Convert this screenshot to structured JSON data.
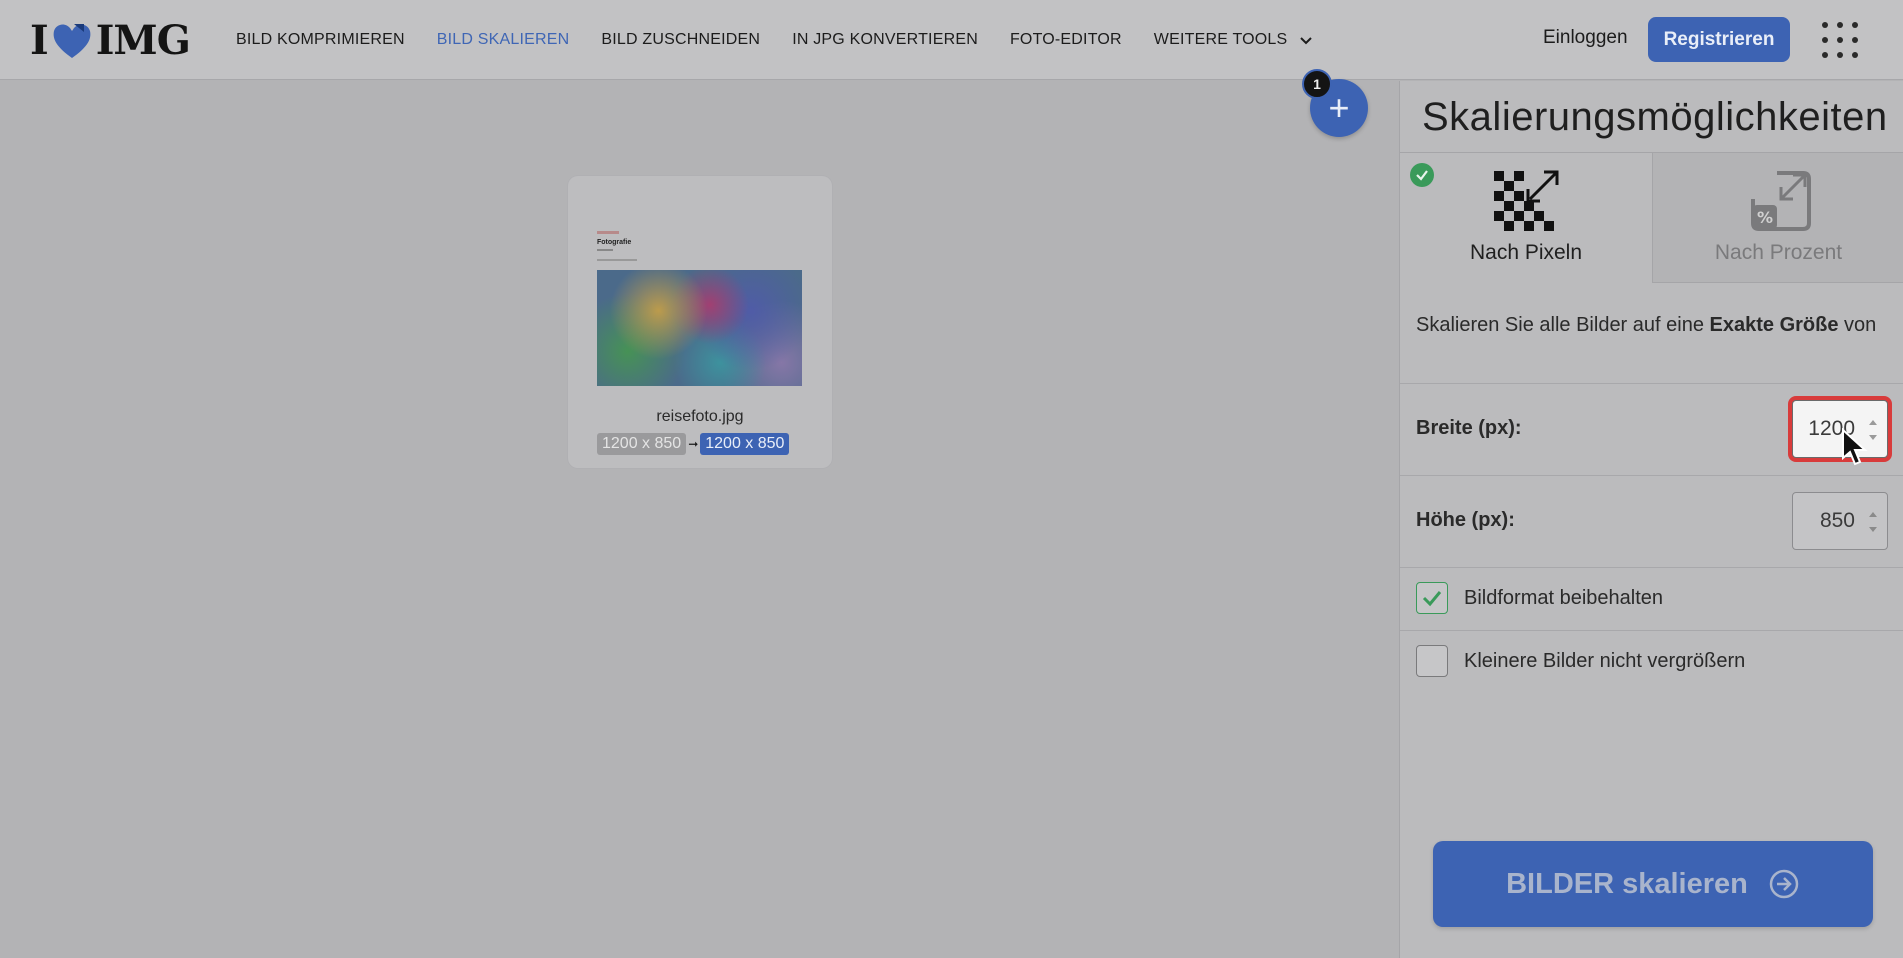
{
  "header": {
    "logo_left": "I",
    "logo_right": "IMG",
    "nav": [
      {
        "label": "BILD KOMPRIMIEREN",
        "active": false
      },
      {
        "label": "BILD SKALIEREN",
        "active": true
      },
      {
        "label": "BILD ZUSCHNEIDEN",
        "active": false
      },
      {
        "label": "IN JPG KONVERTIEREN",
        "active": false
      },
      {
        "label": "FOTO-EDITOR",
        "active": false
      },
      {
        "label": "WEITERE TOOLS",
        "active": false
      }
    ],
    "login_label": "Einloggen",
    "register_label": "Registrieren"
  },
  "workspace": {
    "file": {
      "name": "reisefoto.jpg",
      "original_size": "1200 x 850",
      "new_size": "1200 x 850",
      "preview_title": "Fotografie"
    },
    "file_count": "1",
    "add_label": "+"
  },
  "sidebar": {
    "title": "Skalierungsmöglichkeiten",
    "tabs": [
      {
        "label": "Nach Pixeln",
        "selected": true
      },
      {
        "label": "Nach Prozent",
        "selected": false
      }
    ],
    "description_prefix": "Skalieren Sie alle Bilder auf eine",
    "description_bold": "Exakte Größe",
    "description_suffix": "von",
    "width_label": "Breite (px):",
    "width_value": "1200",
    "height_label": "Höhe (px):",
    "height_value": "850",
    "keep_ratio_label": "Bildformat beibehalten",
    "keep_ratio_checked": true,
    "no_enlarge_label": "Kleinere Bilder nicht vergrößern",
    "no_enlarge_checked": false,
    "action_label": "BILDER skalieren"
  },
  "colors": {
    "accent": "#3d63b3",
    "success": "#3a9a5a",
    "focus_ring": "#d83b3b"
  }
}
